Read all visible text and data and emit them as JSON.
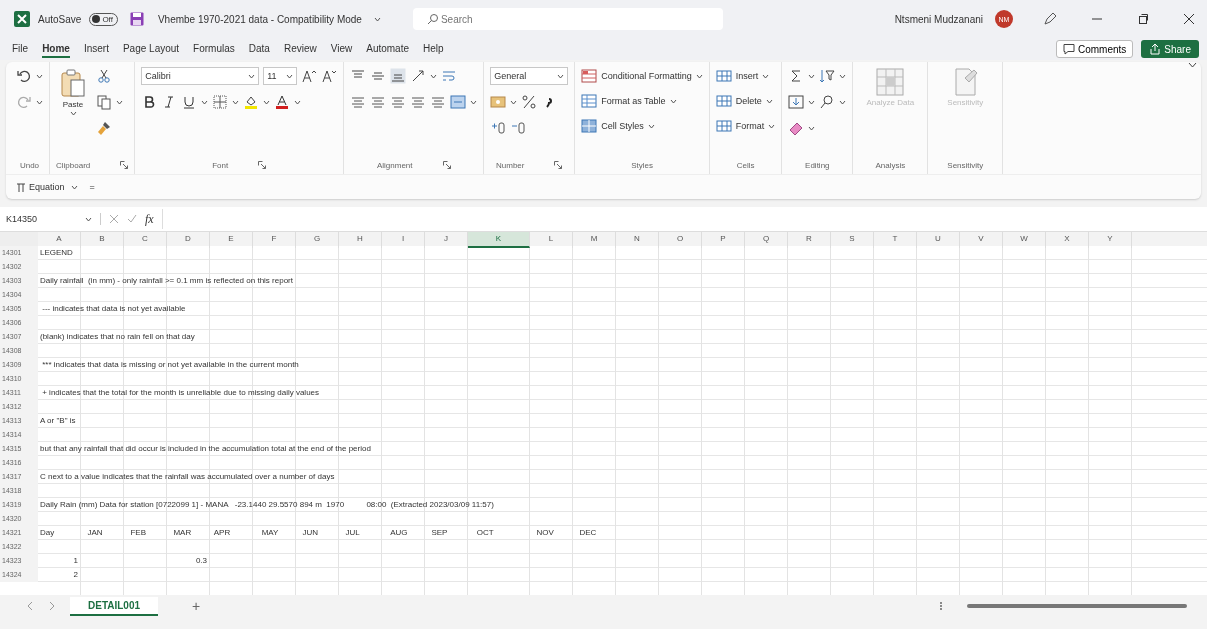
{
  "title_bar": {
    "autosave_label": "AutoSave",
    "autosave_toggle": {
      "label": "Off",
      "on": false
    },
    "document_title": "Vhembe 1970-2021 data - Compatibility Mode",
    "search": {
      "placeholder": "Search"
    },
    "user_name": "Ntsmeni Mudzanani",
    "avatar_initials": "NM"
  },
  "menu_tabs": [
    {
      "label": "File",
      "selected": false
    },
    {
      "label": "Home",
      "selected": true
    },
    {
      "label": "Insert",
      "selected": false
    },
    {
      "label": "Page Layout",
      "selected": false
    },
    {
      "label": "Formulas",
      "selected": false
    },
    {
      "label": "Data",
      "selected": false
    },
    {
      "label": "Review",
      "selected": false
    },
    {
      "label": "View",
      "selected": false
    },
    {
      "label": "Automate",
      "selected": false
    },
    {
      "label": "Help",
      "selected": false
    }
  ],
  "comments_button": "Comments",
  "share_button": "Share",
  "ribbon": {
    "groups": [
      {
        "label": "Undo",
        "kind": "undo"
      },
      {
        "label": "Clipboard",
        "kind": "clipboard",
        "paste": "Paste"
      },
      {
        "label": "Font",
        "kind": "font",
        "font_name": "Calibri",
        "font_size": "11"
      },
      {
        "label": "Alignment",
        "kind": "alignment"
      },
      {
        "label": "Number",
        "kind": "number",
        "format": "General"
      },
      {
        "label": "Styles",
        "kind": "commands",
        "commands": [
          "Conditional Formatting",
          "Format as Table",
          "Cell Styles"
        ]
      },
      {
        "label": "Cells",
        "kind": "commands",
        "commands": [
          "Insert",
          "Delete",
          "Format"
        ]
      },
      {
        "label": "Editing",
        "kind": "editing"
      },
      {
        "label": "Analysis",
        "kind": "big",
        "button": "Analyze Data",
        "disabled": true
      },
      {
        "label": "Sensitivity",
        "kind": "big",
        "button": "Sensitivity",
        "disabled": true
      }
    ]
  },
  "equation_bar": {
    "equation_button": "Equation",
    "equals": "="
  },
  "formula_bar": {
    "name_box": "K14350",
    "function_label": "fx"
  },
  "sheet": {
    "columns": [
      {
        "label": "A",
        "selected": false
      },
      {
        "label": "B",
        "selected": false
      },
      {
        "label": "C",
        "selected": false
      },
      {
        "label": "D",
        "selected": false
      },
      {
        "label": "E",
        "selected": false
      },
      {
        "label": "F",
        "selected": false
      },
      {
        "label": "G",
        "selected": false
      },
      {
        "label": "H",
        "selected": false
      },
      {
        "label": "I",
        "selected": false
      },
      {
        "label": "J",
        "selected": false
      },
      {
        "label": "K",
        "selected": true
      },
      {
        "label": "L",
        "selected": false
      },
      {
        "label": "M",
        "selected": false
      },
      {
        "label": "N",
        "selected": false
      },
      {
        "label": "O",
        "selected": false
      },
      {
        "label": "P",
        "selected": false
      },
      {
        "label": "Q",
        "selected": false
      },
      {
        "label": "R",
        "selected": false
      },
      {
        "label": "S",
        "selected": false
      },
      {
        "label": "T",
        "selected": false
      },
      {
        "label": "U",
        "selected": false
      },
      {
        "label": "V",
        "selected": false
      },
      {
        "label": "W",
        "selected": false
      },
      {
        "label": "X",
        "selected": false
      },
      {
        "label": "Y",
        "selected": false
      }
    ],
    "rows": [
      {
        "number": "14301",
        "cells": [
          {
            "text": "LEGEND",
            "kind": "text"
          }
        ]
      },
      {
        "number": "14302",
        "cells": []
      },
      {
        "number": "14303",
        "cells": [
          {
            "text": "Daily rainfall  (in mm) - only rainfall >= 0.1 mm is reflected on this report",
            "kind": "text"
          }
        ]
      },
      {
        "number": "14304",
        "cells": []
      },
      {
        "number": "14305",
        "cells": [
          {
            "text": " --- indicates that data is not yet available",
            "kind": "text"
          }
        ]
      },
      {
        "number": "14306",
        "cells": []
      },
      {
        "number": "14307",
        "cells": [
          {
            "text": "(blank) indicates that no rain fell on that day",
            "kind": "text"
          }
        ]
      },
      {
        "number": "14308",
        "cells": []
      },
      {
        "number": "14309",
        "cells": [
          {
            "text": " *** indicates that data is missing or not yet available in the current month",
            "kind": "text"
          }
        ]
      },
      {
        "number": "14310",
        "cells": []
      },
      {
        "number": "14311",
        "cells": [
          {
            "text": " + indicates that the total for the month is unreliable due to missing daily values",
            "kind": "text"
          }
        ]
      },
      {
        "number": "14312",
        "cells": []
      },
      {
        "number": "14313",
        "cells": [
          {
            "text": "A or \"B\" is",
            "kind": "text"
          }
        ]
      },
      {
        "number": "14314",
        "cells": []
      },
      {
        "number": "14315",
        "cells": [
          {
            "text": "but that any rainfall that did occur is included in the accumulation total at the end of the period",
            "kind": "text"
          }
        ]
      },
      {
        "number": "14316",
        "cells": []
      },
      {
        "number": "14317",
        "cells": [
          {
            "text": "C next to a value indicates that the rainfall was accumulated over a number of days",
            "kind": "text"
          }
        ]
      },
      {
        "number": "14318",
        "cells": []
      },
      {
        "number": "14319",
        "cells": [
          {
            "text": "Daily Rain (mm) Data for station [0722099 1] - MANA   -23.1440 29.5570 894 m  1970          08:00  (Extracted 2023/03/09 11:57)",
            "kind": "text"
          }
        ]
      },
      {
        "number": "14320",
        "cells": []
      },
      {
        "number": "14321",
        "cells": [
          {
            "text": "Day",
            "kind": "text"
          },
          {
            "text": "  JAN",
            "kind": "text"
          },
          {
            "text": "  FEB",
            "kind": "text"
          },
          {
            "text": "  MAR",
            "kind": "text"
          },
          {
            "text": " APR",
            "kind": "text"
          },
          {
            "text": "   MAY",
            "kind": "text"
          },
          {
            "text": "  JUN",
            "kind": "text"
          },
          {
            "text": "  JUL",
            "kind": "text"
          },
          {
            "text": "   AUG",
            "kind": "text"
          },
          {
            "text": "  SEP",
            "kind": "text"
          },
          {
            "text": "   OCT",
            "kind": "text"
          },
          {
            "text": "  NOV",
            "kind": "text"
          },
          {
            "text": "  DEC",
            "kind": "text"
          }
        ]
      },
      {
        "number": "14322",
        "cells": []
      },
      {
        "number": "14323",
        "cells": [
          {
            "text": "1",
            "kind": "number"
          },
          null,
          null,
          {
            "text": "0.3",
            "kind": "number"
          }
        ]
      },
      {
        "number": "14324",
        "cells": [
          {
            "text": "2",
            "kind": "number"
          }
        ]
      }
    ]
  },
  "sheet_tabs": [
    {
      "label": "DETAIL001",
      "selected": true
    }
  ],
  "add_sheet": "+"
}
